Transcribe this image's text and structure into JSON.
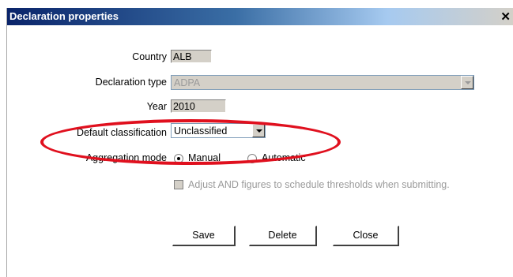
{
  "dialog": {
    "title": "Declaration properties",
    "close_glyph": "✕"
  },
  "form": {
    "country": {
      "label": "Country",
      "value": "ALB"
    },
    "declaration_type": {
      "label": "Declaration type",
      "value": "ADPA"
    },
    "year": {
      "label": "Year",
      "value": "2010"
    },
    "default_classification": {
      "label": "Default classification",
      "value": "Unclassified"
    },
    "aggregation_mode": {
      "label": "Aggregation mode",
      "options": [
        "Manual",
        "Automatic"
      ],
      "selected": "Manual"
    },
    "adjust_checkbox": {
      "label": "Adjust AND figures to schedule thresholds when submitting.",
      "checked": false,
      "enabled": false
    }
  },
  "buttons": {
    "save": "Save",
    "delete": "Delete",
    "close": "Close"
  },
  "colors": {
    "highlight_ellipse": "#e0101e",
    "titlebar": "#0a246a"
  }
}
